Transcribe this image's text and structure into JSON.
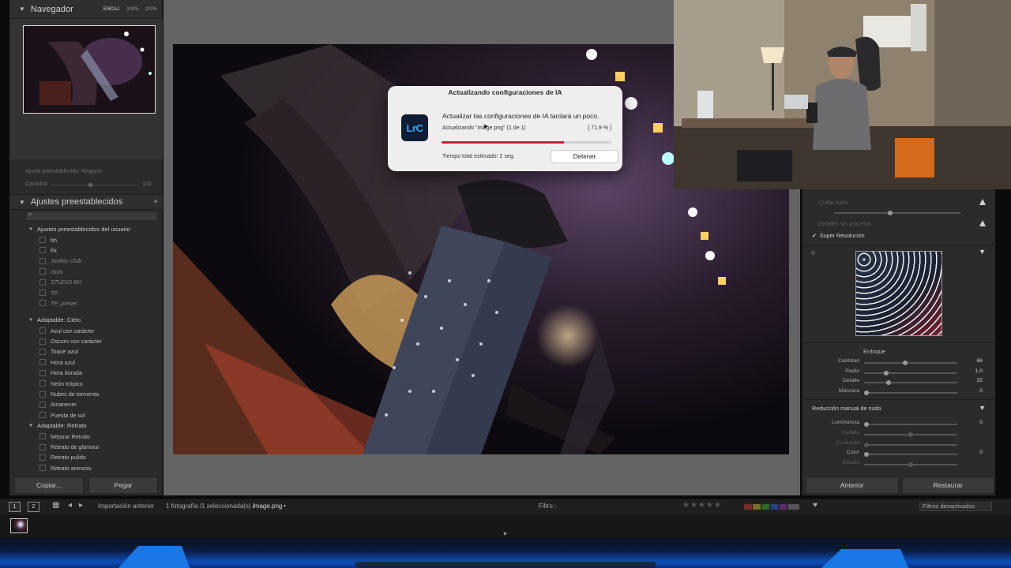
{
  "navigator": {
    "title": "Navegador",
    "zoom_options": [
      "ENCAJ.",
      "100%",
      "200%"
    ]
  },
  "faded": {
    "presets_amount": "Ajuste preestablecido: Ninguno",
    "amount_label": "Cantidad",
    "amount_value": "100"
  },
  "presets": {
    "title": "Ajustes preestablecidos",
    "groups": [
      {
        "name": "Ajustes preestablecidos del usuario",
        "items": [
          "bh",
          "frk",
          "Jockey Club",
          "risos",
          "STUDIO BH",
          "TP",
          "TP_preset"
        ],
        "italic_from": 2
      },
      {
        "name": "Adaptable: Cielo",
        "items": [
          "Azul con carácter",
          "Oscuro con carácter",
          "Toque azul",
          "Hora azul",
          "Hora dorada",
          "Neón trópico",
          "Nubes de tormenta",
          "Amanecer",
          "Puesta de sol"
        ],
        "italic_from": 99
      },
      {
        "name": "Adaptable: Retrato",
        "items": [
          "Mejorar Retrato",
          "Retrato de glamour",
          "Retrato pulido",
          "Retrato arenoso"
        ],
        "italic_from": 99
      }
    ]
  },
  "left_buttons": {
    "copy": "Copiar...",
    "paste": "Pegar"
  },
  "dialog": {
    "title": "Actualizando configuraciones de IA",
    "logo": "LrC",
    "message": "Actualizar las configuraciones de IA tardará un poco.",
    "file_status": "Actualizando \"image.png\" (1 de 1)",
    "percent_text": "[ 71.9 % ]",
    "progress": 0.719,
    "eta": "Tiempo total estimado: 2 seg.",
    "stop_button": "Detener"
  },
  "right_panel": {
    "remove_noise": "Quitar ruido",
    "raw_details": "Detalles sin procesar",
    "super_resolution": "Super Resolución",
    "sharpening_title": "Enfoque",
    "sharpening": [
      {
        "label": "Cantidad",
        "value": "66",
        "pos": 0.44
      },
      {
        "label": "Radio",
        "value": "1,0",
        "pos": 0.22
      },
      {
        "label": "Detalle",
        "value": "25",
        "pos": 0.25
      },
      {
        "label": "Máscara",
        "value": "0",
        "pos": 0.0
      }
    ],
    "noise_title": "Reducción manual de ruido",
    "noise": [
      {
        "label": "Luminancia",
        "value": "0",
        "pos": 0.0,
        "dim": false
      },
      {
        "label": "Detalle",
        "value": "",
        "pos": 0.5,
        "dim": true
      },
      {
        "label": "Contraste",
        "value": "",
        "pos": 0.0,
        "dim": true
      },
      {
        "label": "Color",
        "value": "0",
        "pos": 0.0,
        "dim": false
      },
      {
        "label": "Detalle",
        "value": "",
        "pos": 0.5,
        "dim": true
      }
    ],
    "prev_button": "Anterior",
    "reset_button": "Restaurar"
  },
  "film_toolbar": {
    "monitor1": "1",
    "monitor2": "2",
    "source": "Importación anterior",
    "selection": "1 fotografía /1 seleccionada(s) /",
    "filename": "image.png",
    "filter_label": "Filtro :",
    "filters_off": "Filtros desactivados"
  },
  "colors": {
    "accent_progress": "#d51d36",
    "lrc_blue": "#31a8ff"
  }
}
